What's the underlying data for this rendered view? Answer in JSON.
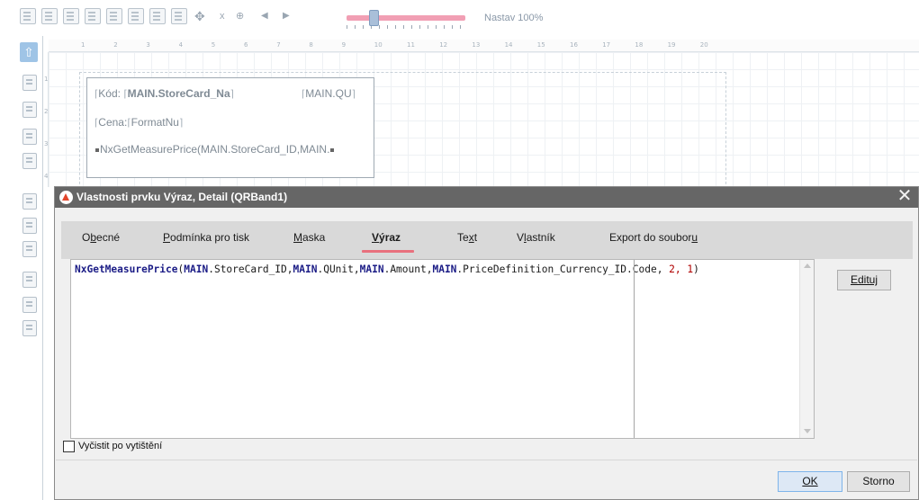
{
  "toolbar": {
    "zoom_label": "Nastav 100%",
    "zoom_x_label": "x",
    "zoom_level_fraction": 0.23
  },
  "band": {
    "field_code_label": "Kód:",
    "field_code_value": "MAIN.StoreCard_Na",
    "field_qunit": "MAIN.QU",
    "field_price_label": "Cena:",
    "field_price_value": "FormatNu",
    "field_measure": "NxGetMeasurePrice(MAIN.StoreCard_ID,MAIN."
  },
  "dialog": {
    "title": "Vlastnosti prvku Výraz, Detail (QRBand1)",
    "close_glyph": "✕",
    "tabs": [
      {
        "label_pre": "O",
        "label_acc": "b",
        "label_post": "ecné"
      },
      {
        "label_pre": "",
        "label_acc": "P",
        "label_post": "odmínka pro tisk"
      },
      {
        "label_pre": "",
        "label_acc": "M",
        "label_post": "aska"
      },
      {
        "label_pre": "",
        "label_acc": "V",
        "label_post": "ýraz",
        "active": true
      },
      {
        "label_pre": "Te",
        "label_acc": "x",
        "label_post": "t"
      },
      {
        "label_pre": "V",
        "label_acc": "l",
        "label_post": "astník"
      },
      {
        "label_pre": "Export do soubor",
        "label_acc": "u",
        "label_post": ""
      }
    ],
    "expression": {
      "fn": "NxGetMeasurePrice",
      "paren_open": "(",
      "a1_src": "MAIN",
      "a1_rest": ".StoreCard_ID,",
      "a2_src": "MAIN",
      "a2_rest": ".QUnit,",
      "a3_src": "MAIN",
      "a3_rest": ".Amount,",
      "a4_src": "MAIN",
      "a4_rest": ".PriceDefinition_Currency_ID.Code,",
      "n1": " 2,",
      "n2": " 1",
      "paren_close": ")"
    },
    "edit_button": "Edituj",
    "clear_after_print_label": "Vyčistit po vytištění",
    "clear_after_print_checked": false,
    "ok_button": "OK",
    "cancel_button": "Storno"
  }
}
